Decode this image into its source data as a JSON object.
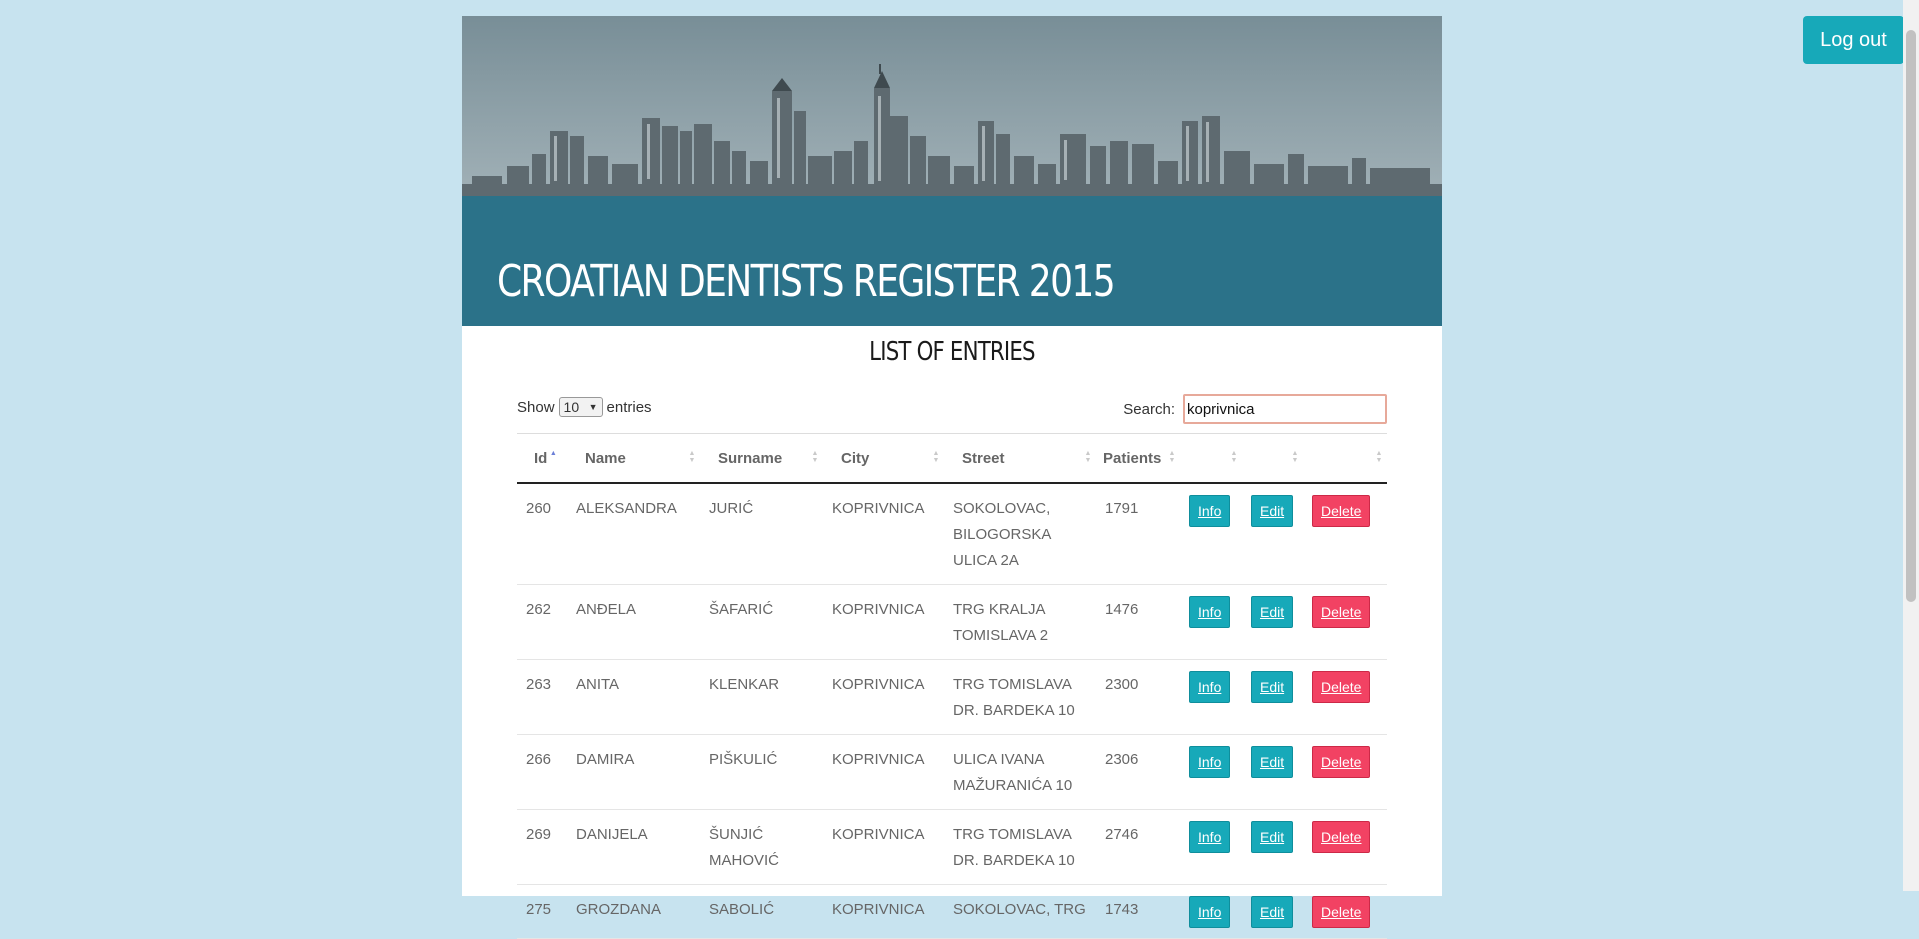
{
  "header": {
    "logout_label": "Log out"
  },
  "banner": {
    "title": "CROATIAN DENTISTS REGISTER 2015"
  },
  "list": {
    "title": "LIST OF ENTRIES"
  },
  "controls": {
    "show_label": "Show",
    "length_value": "10",
    "entries_label": "entries",
    "search_label": "Search:",
    "search_value": "koprivnica"
  },
  "table": {
    "columns": [
      "Id",
      "Name",
      "Surname",
      "City",
      "Street",
      "Patients",
      "",
      "",
      ""
    ],
    "sorted_column": "Id",
    "sort_direction": "ascending",
    "actions": {
      "info": "Info",
      "edit": "Edit",
      "delete": "Delete"
    },
    "rows": [
      {
        "id": "260",
        "name": "ALEKSANDRA",
        "surname": "JURIĆ",
        "city": "KOPRIVNICA",
        "street": "SOKOLOVAC, BILOGORSKA ULICA 2A",
        "patients": "1791"
      },
      {
        "id": "262",
        "name": "ANĐELA",
        "surname": "ŠAFARIĆ",
        "city": "KOPRIVNICA",
        "street": "TRG KRALJA TOMISLAVA 2",
        "patients": "1476"
      },
      {
        "id": "263",
        "name": "ANITA",
        "surname": "KLENKAR",
        "city": "KOPRIVNICA",
        "street": "TRG TOMISLAVA DR. BARDEKA 10",
        "patients": "2300"
      },
      {
        "id": "266",
        "name": "DAMIRA",
        "surname": "PIŠKULIĆ",
        "city": "KOPRIVNICA",
        "street": "ULICA IVANA MAŽURANIĆA 10",
        "patients": "2306"
      },
      {
        "id": "269",
        "name": "DANIJELA",
        "surname": "ŠUNJIĆ MAHOVIĆ",
        "city": "KOPRIVNICA",
        "street": "TRG TOMISLAVA DR. BARDEKA 10",
        "patients": "2746"
      },
      {
        "id": "275",
        "name": "GROZDANA",
        "surname": "SABOLIĆ",
        "city": "KOPRIVNICA",
        "street": "SOKOLOVAC, TRG",
        "patients": "1743"
      }
    ]
  },
  "colors": {
    "page_background": "#c7e3ef",
    "title_band": "#2b7289",
    "accent_button": "#17a9b9",
    "delete_button": "#f24263"
  }
}
